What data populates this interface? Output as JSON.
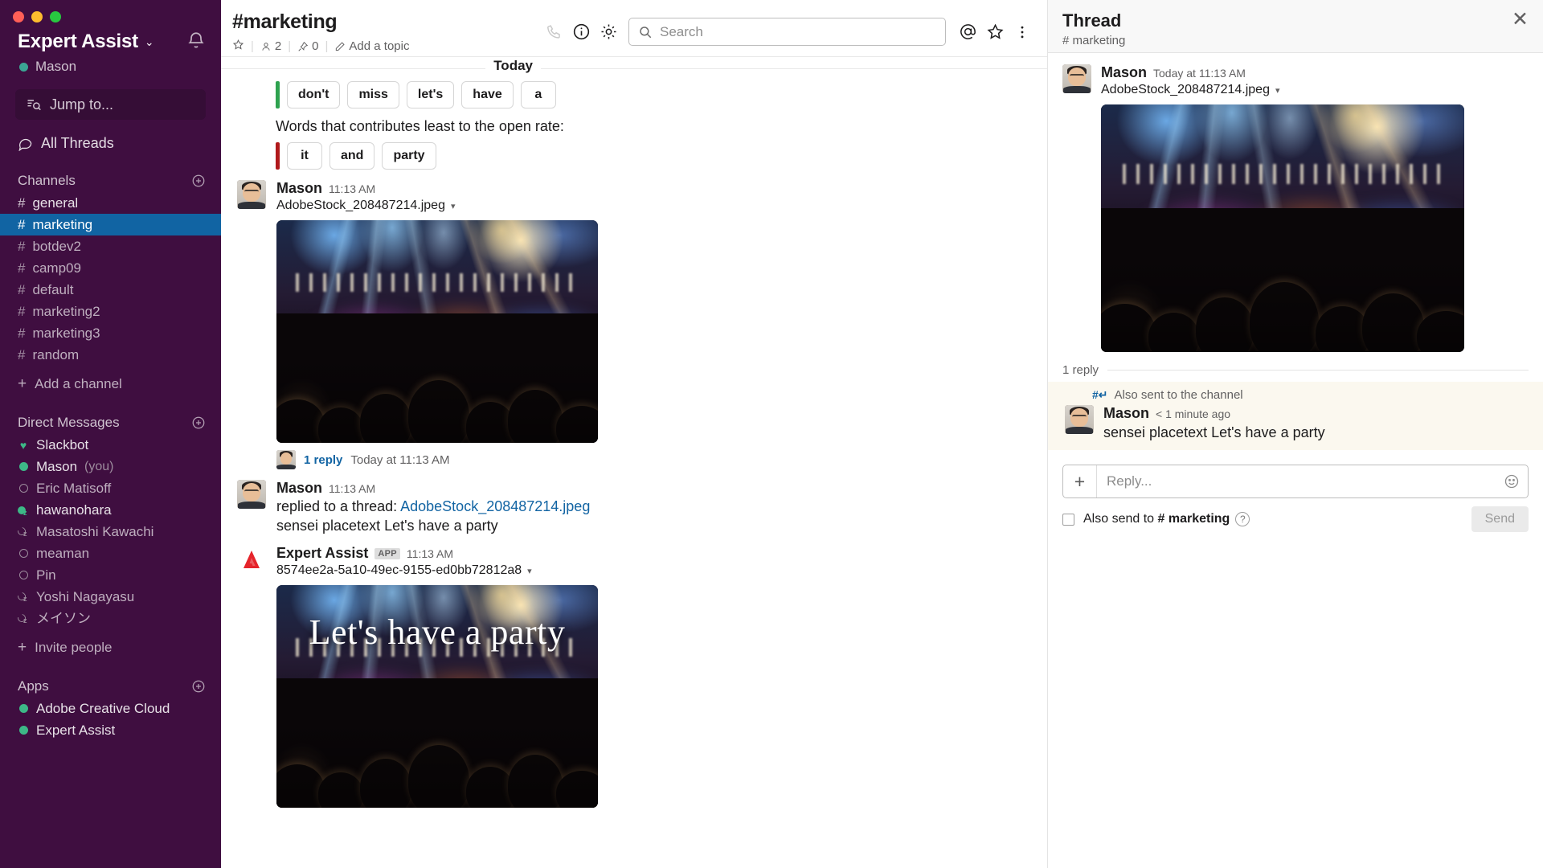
{
  "workspace": {
    "name": "Expert Assist",
    "chevron": "⌄",
    "user": "Mason",
    "jump_placeholder": "Jump to...",
    "all_threads": "All Threads",
    "bell_icon": "bell-icon"
  },
  "sidebar": {
    "channels_header": "Channels",
    "channels": [
      {
        "name": "general",
        "state": "normal"
      },
      {
        "name": "marketing",
        "state": "active"
      },
      {
        "name": "botdev2",
        "state": "muted"
      },
      {
        "name": "camp09",
        "state": "muted"
      },
      {
        "name": "default",
        "state": "muted"
      },
      {
        "name": "marketing2",
        "state": "muted"
      },
      {
        "name": "marketing3",
        "state": "muted"
      },
      {
        "name": "random",
        "state": "muted"
      }
    ],
    "add_channel": "Add a channel",
    "dm_header": "Direct Messages",
    "dms": [
      {
        "name": "Slackbot",
        "presence": "heart",
        "suffix": ""
      },
      {
        "name": "Mason",
        "presence": "online",
        "suffix": "(you)"
      },
      {
        "name": "Eric Matisoff",
        "presence": "offline",
        "suffix": ""
      },
      {
        "name": "hawanohara",
        "presence": "away-active",
        "suffix": ""
      },
      {
        "name": "Masatoshi Kawachi",
        "presence": "away",
        "suffix": ""
      },
      {
        "name": "meaman",
        "presence": "offline",
        "suffix": ""
      },
      {
        "name": "Pin",
        "presence": "offline",
        "suffix": ""
      },
      {
        "name": "Yoshi Nagayasu",
        "presence": "away",
        "suffix": ""
      },
      {
        "name": "メイソン",
        "presence": "away",
        "suffix": ""
      }
    ],
    "invite_people": "Invite people",
    "apps_header": "Apps",
    "apps": [
      {
        "name": "Adobe Creative Cloud",
        "presence": "online"
      },
      {
        "name": "Expert Assist",
        "presence": "online"
      }
    ]
  },
  "topbar": {
    "channel_title": "#marketing",
    "star_icon": "star-icon",
    "members_count": "2",
    "pins_count": "0",
    "add_topic": "Add a topic",
    "call_icon": "phone-icon",
    "info_icon": "info-icon",
    "settings_icon": "gear-icon",
    "mentions_icon": "at-icon",
    "starred_icon": "star-outline-icon",
    "more_icon": "kebab-menu-icon"
  },
  "search": {
    "placeholder": "Search",
    "icon": "search-icon"
  },
  "channel": {
    "today_label": "Today",
    "top_words": [
      "don't",
      "miss",
      "let's",
      "have",
      "a"
    ],
    "least_words_label": "Words that contributes least to the open rate:",
    "least_words": [
      "it",
      "and",
      "party"
    ],
    "messages": [
      {
        "author": "Mason",
        "time": "11:13 AM",
        "filename": "AdobeStock_208487214.jpeg",
        "reply_count": "1 reply",
        "reply_when": "Today at 11:13 AM"
      },
      {
        "author": "Mason",
        "time": "11:13 AM",
        "replied_prefix": "replied to a thread:",
        "replied_link": "AdobeStock_208487214.jpeg",
        "text": "sensei placetext Let's have a party"
      },
      {
        "author": "Expert Assist",
        "app_badge": "APP",
        "time": "11:13 AM",
        "filename": "8574ee2a-5a10-49ec-9155-ed0bb72812a8",
        "image_caption": "Let's have a party"
      }
    ]
  },
  "thread": {
    "title": "Thread",
    "subtitle": "# marketing",
    "close_icon": "close-icon",
    "root": {
      "author": "Mason",
      "time": "Today at 11:13 AM",
      "filename": "AdobeStock_208487214.jpeg"
    },
    "reply_count": "1 reply",
    "also_sent_label": "Also sent to the channel",
    "reply": {
      "author": "Mason",
      "time": "< 1 minute ago",
      "text": "sensei placetext Let's have a party"
    },
    "composer_placeholder": "Reply...",
    "plus_icon": "plus-icon",
    "emoji_icon": "emoji-icon",
    "also_send_prefix": "Also send to",
    "also_send_channel": "# marketing",
    "help_icon": "help-icon",
    "send_label": "Send"
  },
  "colors": {
    "sidebar_bg": "#3F0E40",
    "active_channel": "#1164A3",
    "link": "#1264A3",
    "accent_positive": "#2EA24F",
    "accent_negative": "#B0191B",
    "presence_online": "#3DB887"
  }
}
